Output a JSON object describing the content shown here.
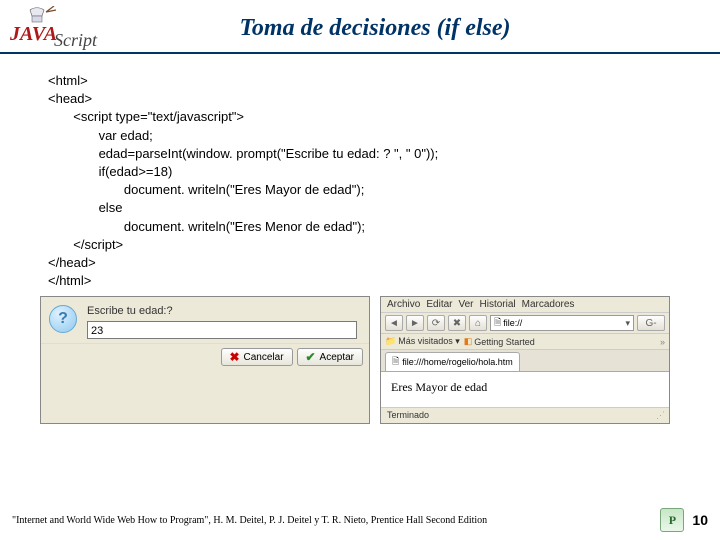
{
  "header": {
    "title": "Toma de decisiones (if else)",
    "logo_text_java": "JAVA",
    "logo_text_script": "Script"
  },
  "code": {
    "l1": "<html>",
    "l2": "<head>",
    "l3": "<script type=\"text/javascript\">",
    "l4": "var edad;",
    "l5": "edad=parseInt(window. prompt(\"Escribe tu edad: ? \", \" 0\"));",
    "l6": "if(edad>=18)",
    "l7": "document. writeln(\"Eres Mayor de edad\");",
    "l8": "else",
    "l9": "document. writeln(\"Eres Menor de edad\");",
    "l10": "</script>",
    "l11": "</head>",
    "l12": "</html>"
  },
  "dialog": {
    "label": "Escribe tu edad:?",
    "value": "23",
    "cancel": "Cancelar",
    "accept": "Aceptar"
  },
  "browser": {
    "menu": {
      "m1": "Archivo",
      "m2": "Editar",
      "m3": "Ver",
      "m4": "Historial",
      "m5": "Marcadores"
    },
    "address_scheme": "file://",
    "toolbar_right": "G-",
    "bookmarks": {
      "b1": "Más visitados ▾",
      "b2": "Getting Started"
    },
    "tab": "file:///home/rogelio/hola.htm",
    "page_text": "Eres Mayor de edad",
    "status": "Terminado"
  },
  "footer": {
    "citation": "\"Internet and World Wide Web How to Program\", H. M. Deitel, P. J. Deitel y T. R. Nieto, Prentice Hall Second Edition",
    "page_number": "10"
  }
}
